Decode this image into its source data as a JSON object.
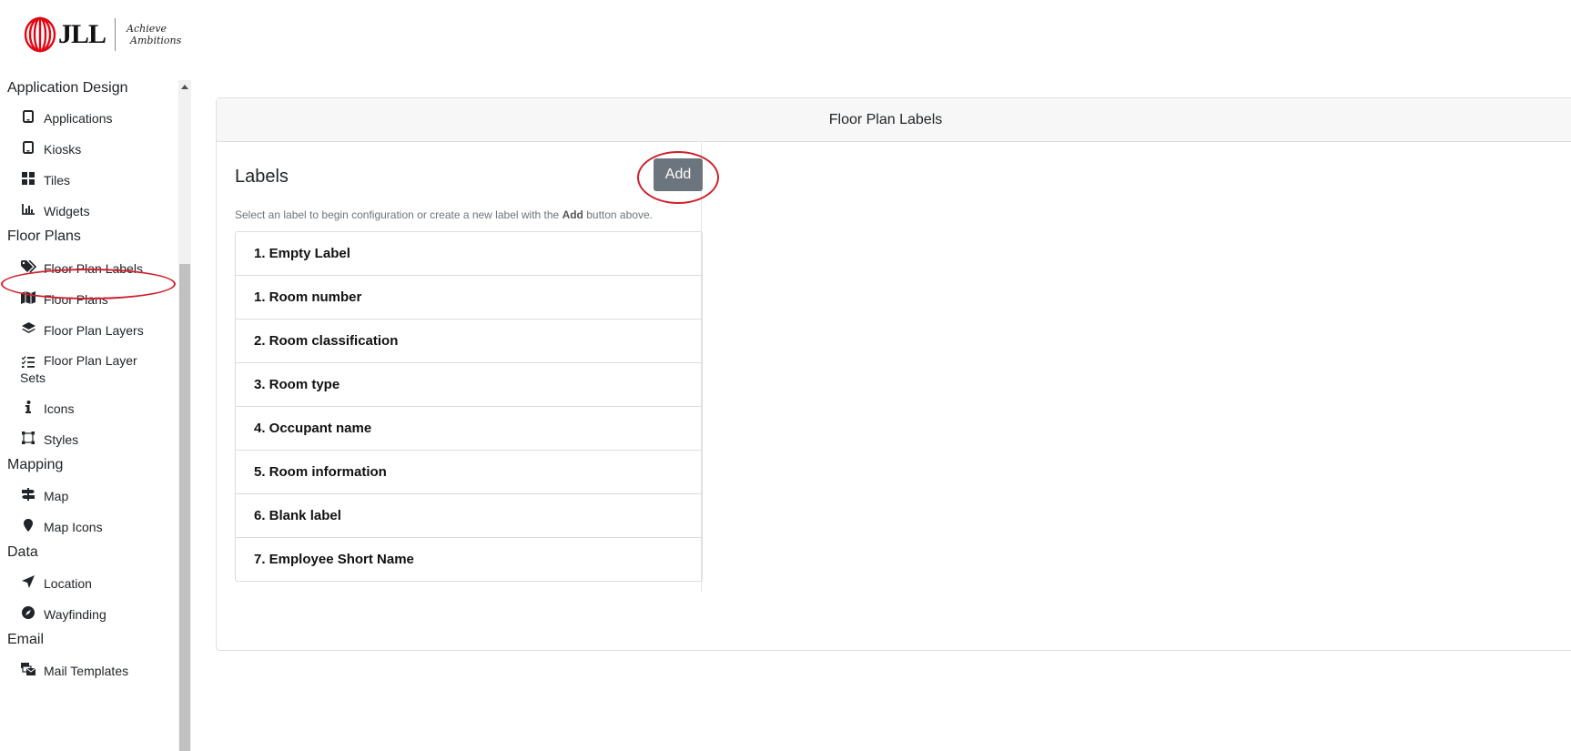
{
  "brand": {
    "name": "JLL",
    "tagline_line1": "Achieve",
    "tagline_line2": "Ambitions",
    "accent": "#e30613"
  },
  "sidebar": {
    "sections": [
      {
        "title": "Application Design",
        "items": [
          {
            "label": "Applications",
            "icon": "tablet-icon"
          },
          {
            "label": "Kiosks",
            "icon": "tablet-icon"
          },
          {
            "label": "Tiles",
            "icon": "grid-icon"
          },
          {
            "label": "Widgets",
            "icon": "chart-icon"
          }
        ]
      },
      {
        "title": "Floor Plans",
        "items": [
          {
            "label": "Floor Plan Labels",
            "icon": "tags-icon",
            "active": true
          },
          {
            "label": "Floor Plans",
            "icon": "map-icon"
          },
          {
            "label": "Floor Plan Layers",
            "icon": "layers-icon"
          },
          {
            "label": "Floor Plan Layer Sets",
            "icon": "tasks-icon"
          },
          {
            "label": "Icons",
            "icon": "info-icon"
          },
          {
            "label": "Styles",
            "icon": "vector-square-icon"
          }
        ]
      },
      {
        "title": "Mapping",
        "items": [
          {
            "label": "Map",
            "icon": "signs-icon"
          },
          {
            "label": "Map Icons",
            "icon": "map-marker-icon"
          }
        ]
      },
      {
        "title": "Data",
        "items": [
          {
            "label": "Location",
            "icon": "location-arrow-icon"
          },
          {
            "label": "Wayfinding",
            "icon": "compass-icon"
          }
        ]
      },
      {
        "title": "Email",
        "items": [
          {
            "label": "Mail Templates",
            "icon": "mail-bulk-icon"
          }
        ]
      }
    ]
  },
  "main": {
    "card_title": "Floor Plan Labels",
    "labels_heading": "Labels",
    "add_button": "Add",
    "help_prefix": "Select an label to begin configuration or create a new label with the ",
    "help_bold": "Add",
    "help_suffix": " button above.",
    "labels": [
      "1. Empty Label",
      "1. Room number",
      "2. Room classification",
      "3. Room type",
      "4. Occupant name",
      "5. Room information",
      "6. Blank label",
      "7. Employee Short Name"
    ]
  },
  "colors": {
    "annotation": "#d0202a",
    "button_bg": "#6c757d",
    "header_bg": "#f7f7f7"
  }
}
